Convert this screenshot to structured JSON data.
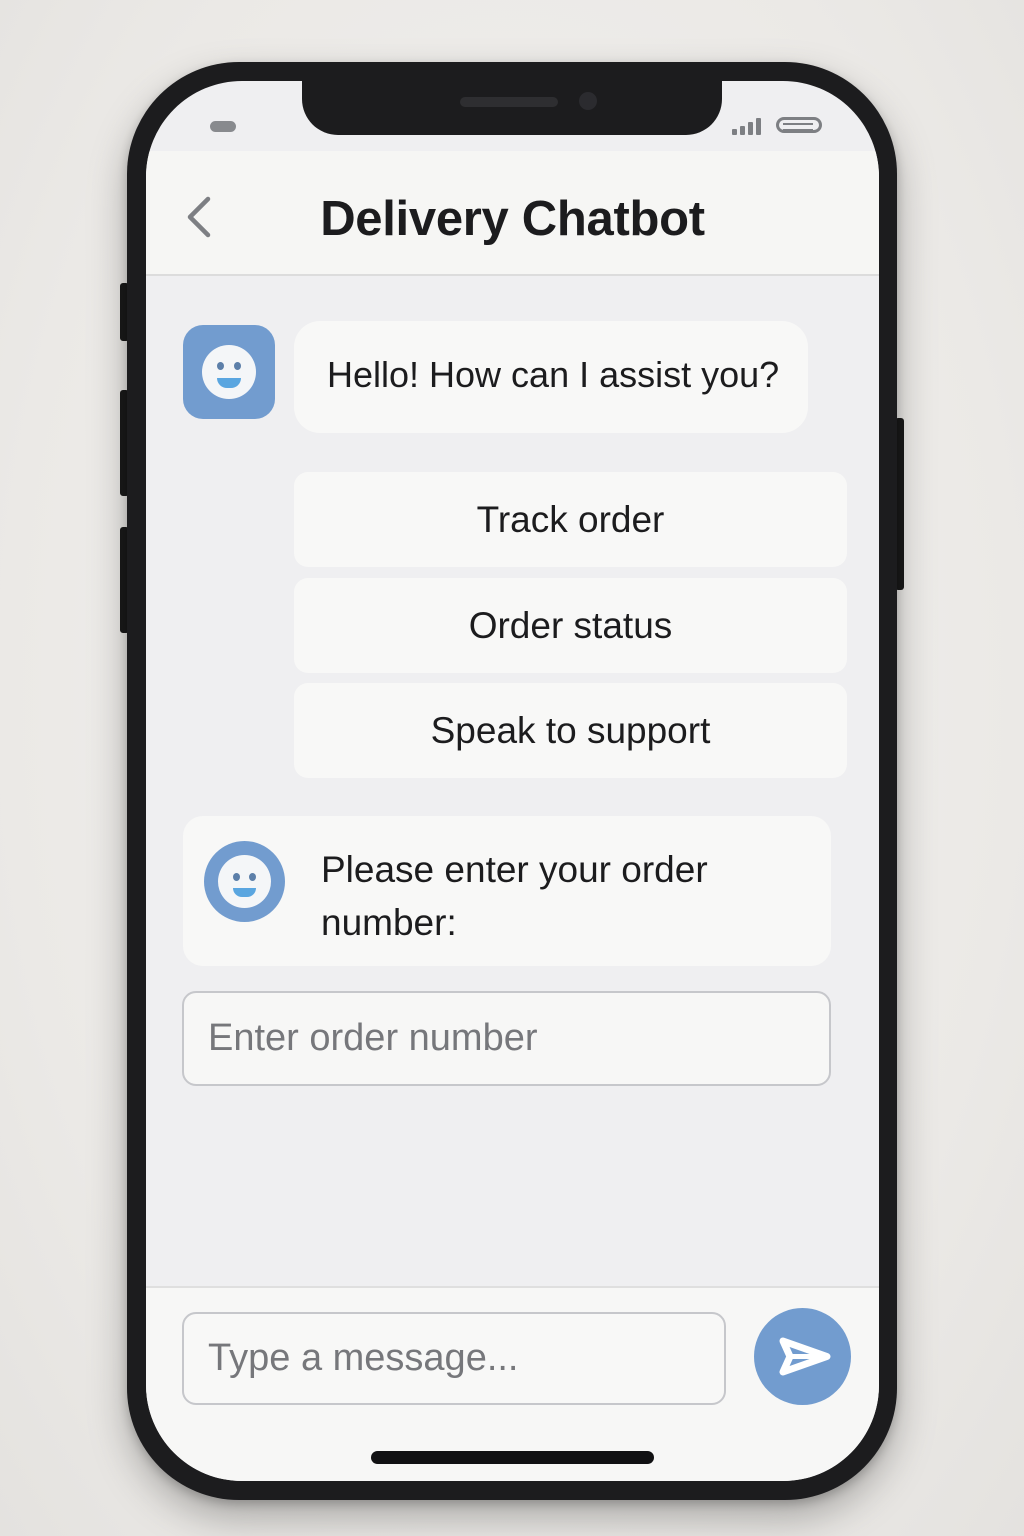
{
  "app": {
    "title": "Delivery Chatbot"
  },
  "icons": {
    "back": "chevron-left-icon",
    "bot_avatar": "smiley-face-icon",
    "send": "paper-plane-icon",
    "signal": "signal-bars-icon",
    "battery": "battery-icon"
  },
  "colors": {
    "accent": "#729ccf",
    "screen_bg": "#efeff1",
    "bubble_bg": "#f8f8f7",
    "text": "#1c1c1e",
    "placeholder": "#76777b"
  },
  "chat": {
    "greeting": "Hello! How can I assist you?",
    "quick_replies": [
      {
        "label": "Track order"
      },
      {
        "label": "Order status"
      },
      {
        "label": "Speak to support"
      }
    ],
    "order_prompt_line1": "Please enter your order",
    "order_prompt_line2": "number:",
    "order_input_placeholder": "Enter order number"
  },
  "composer": {
    "placeholder": "Type a message..."
  }
}
